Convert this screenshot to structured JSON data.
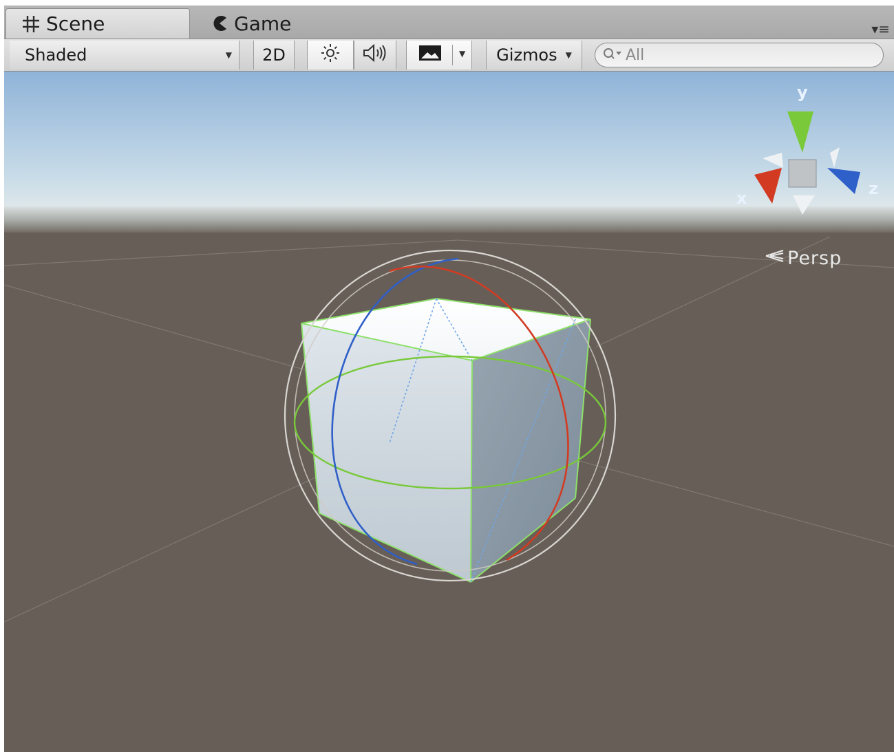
{
  "tabs": [
    {
      "label": "Scene",
      "icon": "grid-icon"
    },
    {
      "label": "Game",
      "icon": "pacman-icon"
    }
  ],
  "toolbar": {
    "draw_mode": "Shaded",
    "mode_2d": "2D",
    "gizmos_label": "Gizmos",
    "search_placeholder": "All"
  },
  "scene": {
    "projection_label": "Persp",
    "axes": {
      "x": "x",
      "y": "y",
      "z": "z"
    },
    "colors": {
      "sky_top": "#8fb3d8",
      "horizon": "#d5dfe3",
      "ground": "#675f57",
      "x_axis": "#d23b22",
      "y_axis": "#79c93a",
      "z_axis": "#2f5fc8",
      "selection_outline": "#8de06a"
    }
  }
}
